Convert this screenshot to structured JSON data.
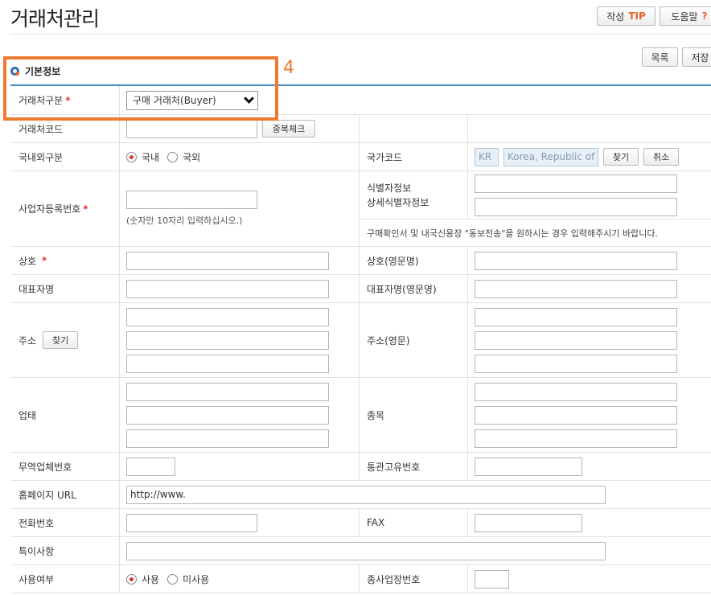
{
  "header": {
    "title": "거래처관리",
    "tip_label": "작성",
    "tip_accent": "TIP",
    "help_label": "도움말",
    "help_accent": "?"
  },
  "toolbar": {
    "list_label": "목록",
    "save_label": "저장"
  },
  "annotation": {
    "number": "4"
  },
  "section": {
    "title": "기본정보"
  },
  "form": {
    "partner_type": {
      "label": "거래처구분",
      "required_mark": "*",
      "selected": "구매 거래처(Buyer)"
    },
    "partner_code": {
      "label": "거래처코드",
      "dup_check_label": "중복체크"
    },
    "domestic": {
      "label": "국내외구분",
      "options": [
        "국내",
        "국외"
      ],
      "selected": "국내"
    },
    "country": {
      "label": "국가코드",
      "code": "KR",
      "name": "Korea, Republic of",
      "find_label": "찾기",
      "cancel_label": "취소"
    },
    "biz_reg": {
      "label": "사업자등록번호",
      "required_mark": "*",
      "hint": "(숫자만 10자리 입력하십시오.)"
    },
    "id_info": {
      "label1": "식별자정보",
      "label2": "상세식별자정보"
    },
    "notice": "구매확인서 및 내국신용장 \"동보전송\"을 원하시는 경우 입력해주시기 바랍니다.",
    "company": {
      "label": "상호",
      "required_mark": "*"
    },
    "company_en": {
      "label": "상호(영문명)"
    },
    "ceo": {
      "label": "대표자명"
    },
    "ceo_en": {
      "label": "대표자명(영문명)"
    },
    "address": {
      "label": "주소",
      "find_label": "찾기"
    },
    "address_en": {
      "label": "주소(영문)"
    },
    "biz_type": {
      "label": "업태"
    },
    "biz_item": {
      "label": "종목"
    },
    "trade_no": {
      "label": "무역업체번호"
    },
    "customs_no": {
      "label": "통관고유번호"
    },
    "homepage": {
      "label": "홈페이지 URL",
      "value": "http://www."
    },
    "phone": {
      "label": "전화번호"
    },
    "fax": {
      "label": "FAX"
    },
    "remarks": {
      "label": "특이사항"
    },
    "usage": {
      "label": "사용여부",
      "options": [
        "사용",
        "미사용"
      ],
      "selected": "사용"
    },
    "branch_no": {
      "label": "종사업장번호"
    }
  },
  "colors": {
    "accent_orange": "#f07a32",
    "required_red": "#e0312a",
    "header_blue": "#4a8bc8"
  }
}
